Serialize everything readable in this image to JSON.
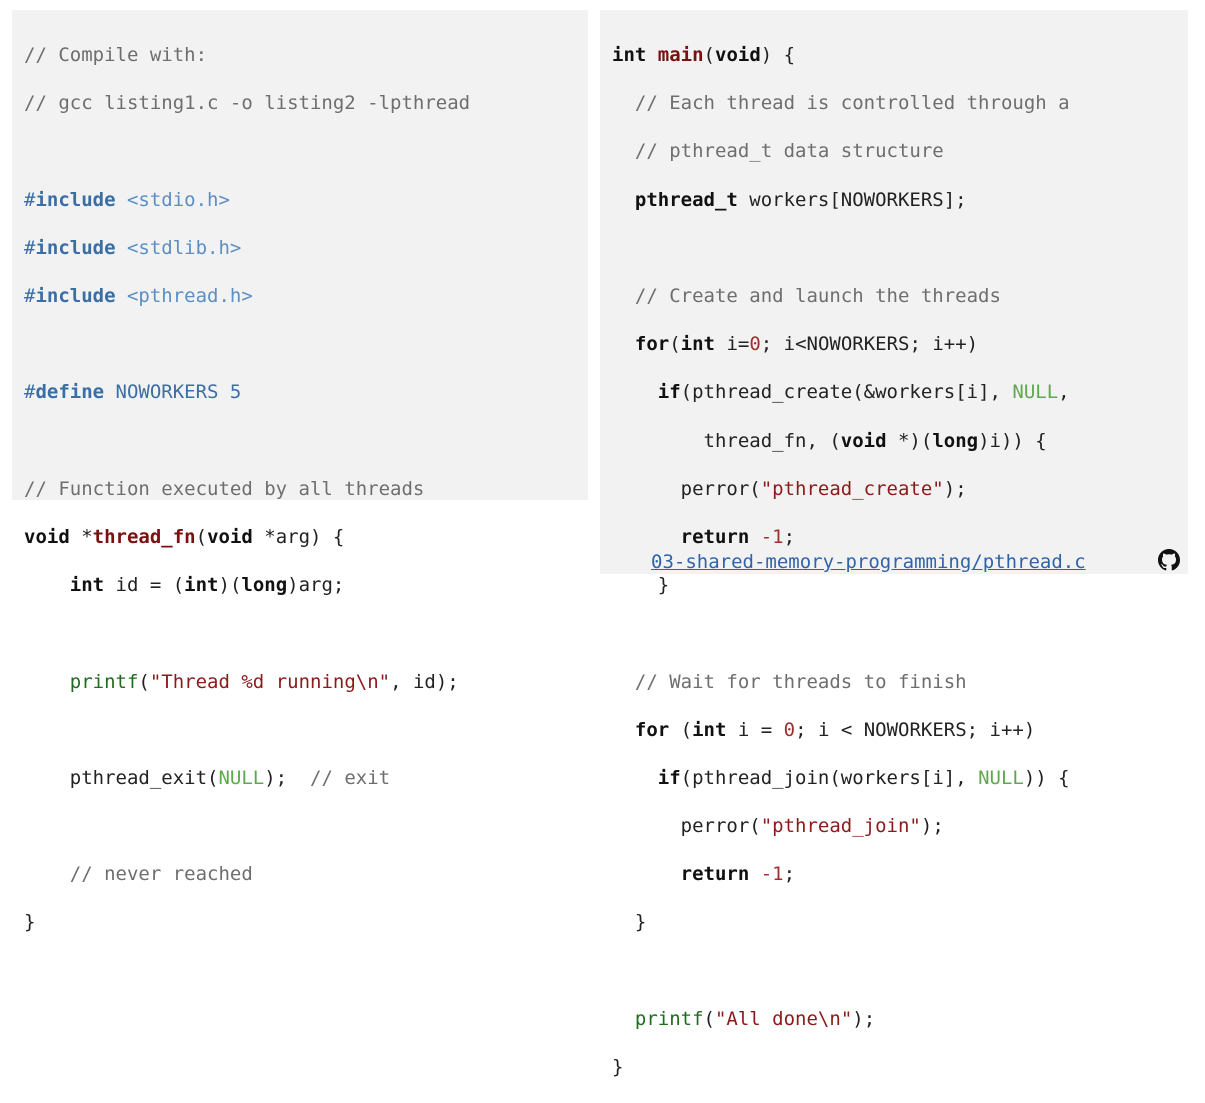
{
  "left_code": {
    "l1": "// Compile with:",
    "l2": "// gcc listing1.c -o listing2 -lpthread",
    "l4_hash": "#",
    "l4_kw": "include",
    "l4_hdr": " <stdio.h>",
    "l5_hash": "#",
    "l5_kw": "include",
    "l5_hdr": " <stdlib.h>",
    "l6_hash": "#",
    "l6_kw": "include",
    "l6_hdr": " <pthread.h>",
    "l8_hash": "#",
    "l8_kw": "define",
    "l8_rest": " NOWORKERS 5",
    "l10": "// Function executed by all threads",
    "l11_kw1": "void",
    "l11_a": " *",
    "l11_fn": "thread_fn",
    "l11_b": "(",
    "l11_kw2": "void",
    "l11_c": " *arg) {",
    "l12_ind": "    ",
    "l12_kw1": "int",
    "l12_a": " id = (",
    "l12_kw2": "int",
    "l12_b": ")(",
    "l12_kw3": "long",
    "l12_c": ")arg;",
    "l14_ind": "    ",
    "l14_fn": "printf",
    "l14_a": "(",
    "l14_str": "\"Thread %d running\\n\"",
    "l14_b": ", id);",
    "l16_a": "    pthread_exit(",
    "l16_null": "NULL",
    "l16_b": ");  ",
    "l16_cm": "// exit",
    "l18_ind": "    ",
    "l18_cm": "// never reached",
    "l19": "}"
  },
  "right_code": {
    "r1_kw1": "int",
    "r1_sp": " ",
    "r1_fn": "main",
    "r1_a": "(",
    "r1_kw2": "void",
    "r1_b": ") {",
    "r2_ind": "  ",
    "r2_cm": "// Each thread is controlled through a",
    "r3_ind": "  ",
    "r3_cm": "// pthread_t data structure",
    "r4_ind": "  ",
    "r4_kw": "pthread_t",
    "r4_rest": " workers[NOWORKERS];",
    "r6_ind": "  ",
    "r6_cm": "// Create and launch the threads",
    "r7_ind": "  ",
    "r7_kw1": "for",
    "r7_a": "(",
    "r7_kw2": "int",
    "r7_b": " i=",
    "r7_num": "0",
    "r7_c": "; i<NOWORKERS; i++)",
    "r8_ind": "    ",
    "r8_kw": "if",
    "r8_a": "(pthread_create(&workers[i], ",
    "r8_null": "NULL",
    "r8_b": ",",
    "r9_a": "        thread_fn, (",
    "r9_kw1": "void",
    "r9_b": " *)(",
    "r9_kw2": "long",
    "r9_c": ")i)) {",
    "r10_a": "      perror(",
    "r10_str": "\"pthread_create\"",
    "r10_b": ");",
    "r11_ind": "      ",
    "r11_kw": "return",
    "r11_sp": " ",
    "r11_num": "-1",
    "r11_b": ";",
    "r12": "    }",
    "r14_ind": "  ",
    "r14_cm": "// Wait for threads to finish",
    "r15_ind": "  ",
    "r15_kw1": "for",
    "r15_a": " (",
    "r15_kw2": "int",
    "r15_b": " i = ",
    "r15_num": "0",
    "r15_c": "; i < NOWORKERS; i++)",
    "r16_ind": "    ",
    "r16_kw": "if",
    "r16_a": "(pthread_join(workers[i], ",
    "r16_null": "NULL",
    "r16_b": ")) {",
    "r17_a": "      perror(",
    "r17_str": "\"pthread_join\"",
    "r17_b": ");",
    "r18_ind": "      ",
    "r18_kw": "return",
    "r18_sp": " ",
    "r18_num": "-1",
    "r18_b": ";",
    "r19": "  }",
    "r21_ind": "  ",
    "r21_fn": "printf",
    "r21_a": "(",
    "r21_str": "\"All done\\n\"",
    "r21_b": ");",
    "r22": "}"
  },
  "footer": {
    "source_link": "03-shared-memory-programming/pthread.c",
    "icon": "github-icon"
  },
  "colors": {
    "panel_bg": "#f2f2f2",
    "comment": "#6e6e6e",
    "preprocessor": "#3a6ea5",
    "header": "#5b8ec4",
    "function_name": "#7a1010",
    "function_call": "#1f6b1f",
    "string": "#8b1a1a",
    "null": "#5fa84f",
    "link": "#2f64a8"
  }
}
